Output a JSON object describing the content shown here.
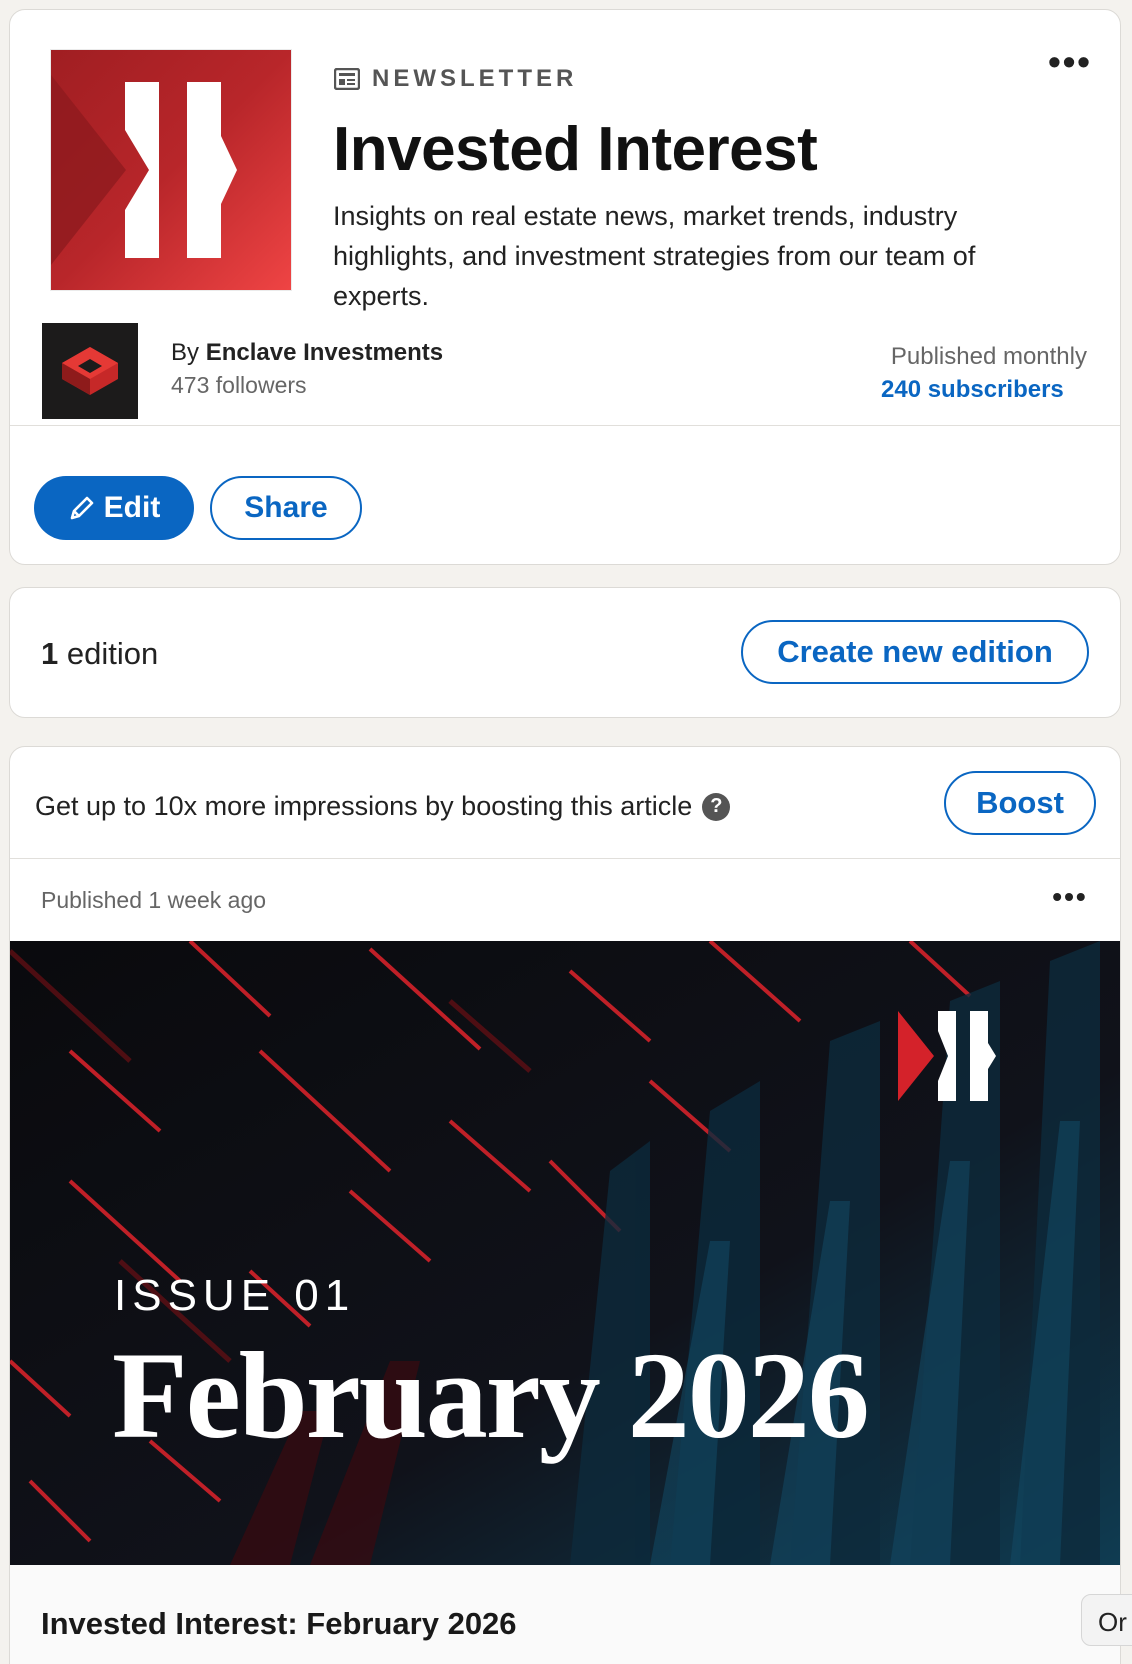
{
  "newsletter": {
    "type_label": "NEWSLETTER",
    "title": "Invested Interest",
    "description": "Insights on real estate news, market trends, industry highlights, and investment strategies from our team of experts.",
    "logo_icon": "enclave-newsletter-logo",
    "more_label": "•••"
  },
  "author": {
    "by_prefix": "By",
    "name": "Enclave Investments",
    "followers": "473 followers"
  },
  "publication": {
    "frequency": "Published monthly",
    "subscribers": "240 subscribers"
  },
  "actions": {
    "edit_label": "Edit",
    "share_label": "Share"
  },
  "editions": {
    "count": "1",
    "label": "edition",
    "create_label": "Create new edition"
  },
  "boost": {
    "text": "Get up to 10x more impressions by boosting this article",
    "help": "?",
    "button_label": "Boost"
  },
  "article": {
    "published": "Published 1 week ago",
    "more_label": "•••",
    "image_issue": "ISSUE 01",
    "image_date": "February 2026",
    "title": "Invested Interest: February 2026"
  },
  "corner_chip": "Or",
  "colors": {
    "accent": "#0a66c2",
    "brand_red": "#d32f2f",
    "page_bg": "#f4f2ee"
  }
}
